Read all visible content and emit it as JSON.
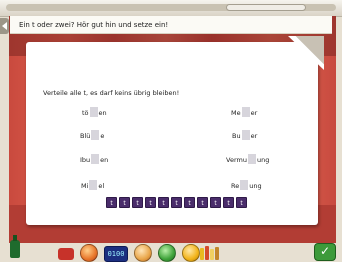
{
  "instruction": "Ein t oder zwei? Hör gut hin und setze ein!",
  "task": {
    "subheading": "Verteile alle t, es darf keins übrig bleiben!",
    "words_left": [
      {
        "before": "tö",
        "after": "en"
      },
      {
        "before": "Blü",
        "after": "e"
      },
      {
        "before": "Ibu",
        "after": "en"
      },
      {
        "before": "Mi",
        "after": "el"
      }
    ],
    "words_right": [
      {
        "before": "Me",
        "after": "er"
      },
      {
        "before": "Bu",
        "after": "er"
      },
      {
        "before": "Vermu",
        "after": "ung"
      },
      {
        "before": "Re",
        "after": "ung"
      }
    ],
    "tiles": [
      "t",
      "t",
      "t",
      "t",
      "t",
      "t",
      "t",
      "t",
      "t",
      "t",
      "t"
    ]
  },
  "toolbar": {
    "clock_text": "0100",
    "ok_symbol": "✓"
  },
  "colors": {
    "tile_bg": "#4a2d6b",
    "stage_red": "#d0504a",
    "ok_green": "#3d9a3a"
  },
  "icons": [
    "back-arrow-icon",
    "bottle-icon",
    "puzzle-icon",
    "orange-ball-icon",
    "clock-icon",
    "ring-icon",
    "green-ball-icon",
    "yellow-ball-icon",
    "books-icon",
    "checkmark-icon"
  ]
}
